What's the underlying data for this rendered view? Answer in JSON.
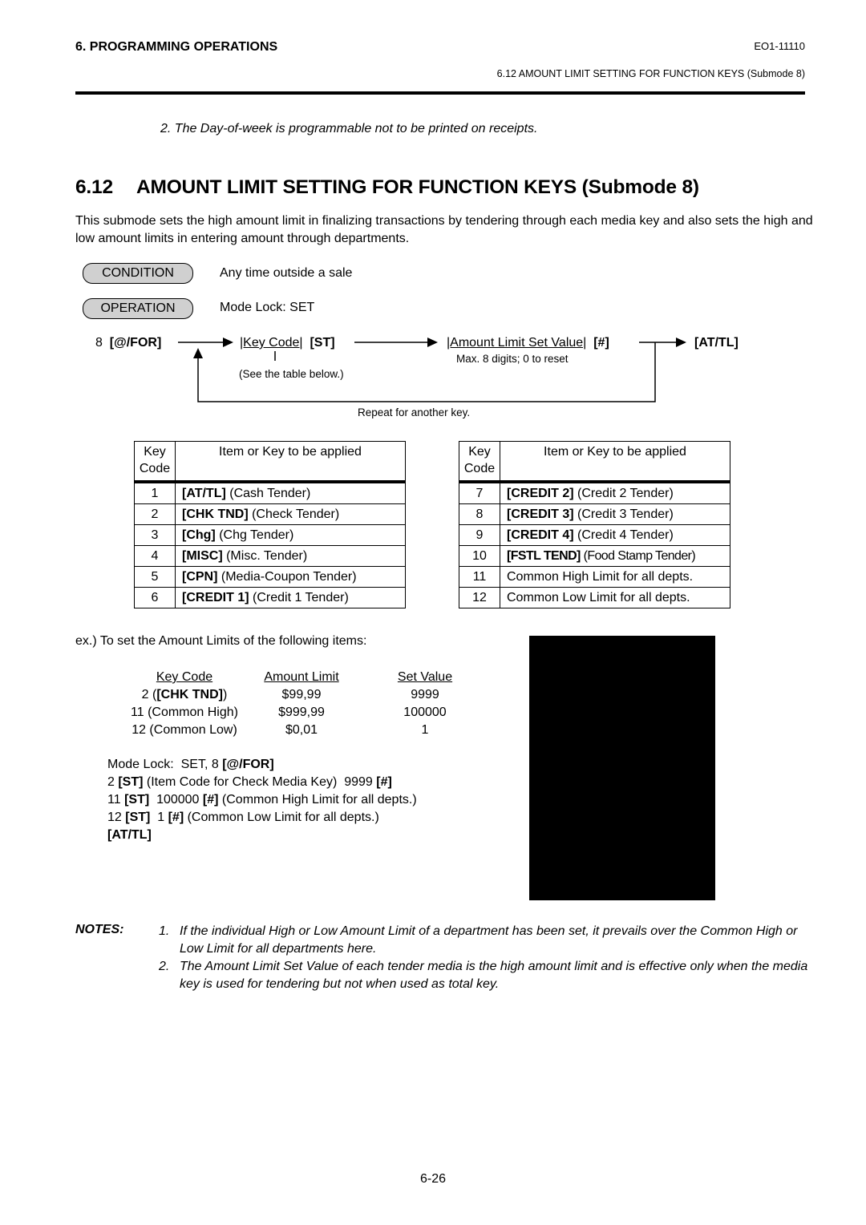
{
  "header": {
    "chapter": "6.  PROGRAMMING OPERATIONS",
    "doc_id": "EO1-11110",
    "section_ref": "6.12  AMOUNT LIMIT SETTING FOR FUNCTION KEYS (Submode 8)"
  },
  "previous_note": "2.  The Day-of-week is programmable not to be printed on receipts.",
  "section": {
    "number": "6.12",
    "title": "AMOUNT LIMIT SETTING FOR FUNCTION KEYS (Submode 8)",
    "intro": "This submode sets the high amount limit in finalizing transactions by tendering through each media key and also sets the high and low amount limits in entering amount through departments."
  },
  "condition": {
    "label": "CONDITION",
    "text": "Any time outside a sale"
  },
  "operation": {
    "label": "OPERATION",
    "text": "Mode Lock:  SET"
  },
  "flow": {
    "start_num": "8",
    "start_key": "[@/FOR]",
    "key_code": "|Key Code|",
    "st": "[ST]",
    "key_code_note": "(See the table below.)",
    "amount": "|Amount Limit Set Value|",
    "hash": "[#]",
    "amount_note": "Max. 8 digits;  0 to reset",
    "end_key": "[AT/TL]",
    "repeat_note": "Repeat for another key."
  },
  "key_table": {
    "headers": {
      "code": "Key Code",
      "item": "Item or Key to be applied"
    },
    "left_rows": [
      {
        "code": "1",
        "key": "[AT/TL]",
        "desc": " (Cash Tender)"
      },
      {
        "code": "2",
        "key": "[CHK TND]",
        "desc": " (Check Tender)"
      },
      {
        "code": "3",
        "key": "[Chg]",
        "desc": " (Chg Tender)"
      },
      {
        "code": "4",
        "key": "[MISC]",
        "desc": " (Misc. Tender)"
      },
      {
        "code": "5",
        "key": "[CPN]",
        "desc": " (Media-Coupon Tender)"
      },
      {
        "code": "6",
        "key": "[CREDIT 1]",
        "desc": " (Credit 1 Tender)"
      }
    ],
    "right_rows": [
      {
        "code": "7",
        "key": "[CREDIT 2]",
        "desc": " (Credit 2 Tender)"
      },
      {
        "code": "8",
        "key": "[CREDIT 3]",
        "desc": " (Credit 3 Tender)"
      },
      {
        "code": "9",
        "key": "[CREDIT 4]",
        "desc": " (Credit 4 Tender)"
      },
      {
        "code": "10",
        "key": "[FSTL TEND]",
        "desc": " (Food Stamp Tender)"
      },
      {
        "code": "11",
        "key": "",
        "desc": "Common High Limit for all depts."
      },
      {
        "code": "12",
        "key": "",
        "desc": "Common Low Limit for all depts."
      }
    ]
  },
  "example": {
    "intro": "ex.)  To set the Amount Limits of the following items:",
    "headers": {
      "key_code": "Key Code",
      "amount_limit": "Amount Limit",
      "set_value": "Set Value"
    },
    "rows": [
      {
        "key_pre": "2 (",
        "key_bold": "[CHK TND]",
        "key_post": ")",
        "amount_limit": "$99,99",
        "set_value": "9999"
      },
      {
        "key_pre": "11 (Common High)",
        "key_bold": "",
        "key_post": "",
        "amount_limit": "$999,99",
        "set_value": "100000"
      },
      {
        "key_pre": "12 (Common Low)",
        "key_bold": "",
        "key_post": "",
        "amount_limit": "$0,01",
        "set_value": "1"
      }
    ],
    "steps": [
      [
        {
          "t": "Mode Lock:  SET, 8 ",
          "b": false
        },
        {
          "t": "[@/FOR]",
          "b": true
        }
      ],
      [
        {
          "t": "2 ",
          "b": false
        },
        {
          "t": "[ST]",
          "b": true
        },
        {
          "t": " (Item Code for Check Media Key)  9999 ",
          "b": false
        },
        {
          "t": "[#]",
          "b": true
        }
      ],
      [
        {
          "t": "11 ",
          "b": false
        },
        {
          "t": "[ST]",
          "b": true
        },
        {
          "t": "  100000 ",
          "b": false
        },
        {
          "t": "[#]",
          "b": true
        },
        {
          "t": " (Common High Limit for all depts.)",
          "b": false
        }
      ],
      [
        {
          "t": "12 ",
          "b": false
        },
        {
          "t": "[ST]",
          "b": true
        },
        {
          "t": "  1 ",
          "b": false
        },
        {
          "t": "[#]",
          "b": true
        },
        {
          "t": " (Common Low Limit for all depts.)",
          "b": false
        }
      ],
      [
        {
          "t": "[AT/TL]",
          "b": true
        }
      ]
    ]
  },
  "notes": {
    "label": "NOTES:",
    "items": [
      {
        "num": "1.",
        "text": "If the individual High or Low Amount Limit of a department has been set, it prevails over the Common High or Low Limit for all departments here."
      },
      {
        "num": "2.",
        "text": "The Amount Limit Set Value of each tender media is the high amount limit and is effective only when the media key is used for tendering but not when used as total key."
      }
    ]
  },
  "page_number": "6-26"
}
